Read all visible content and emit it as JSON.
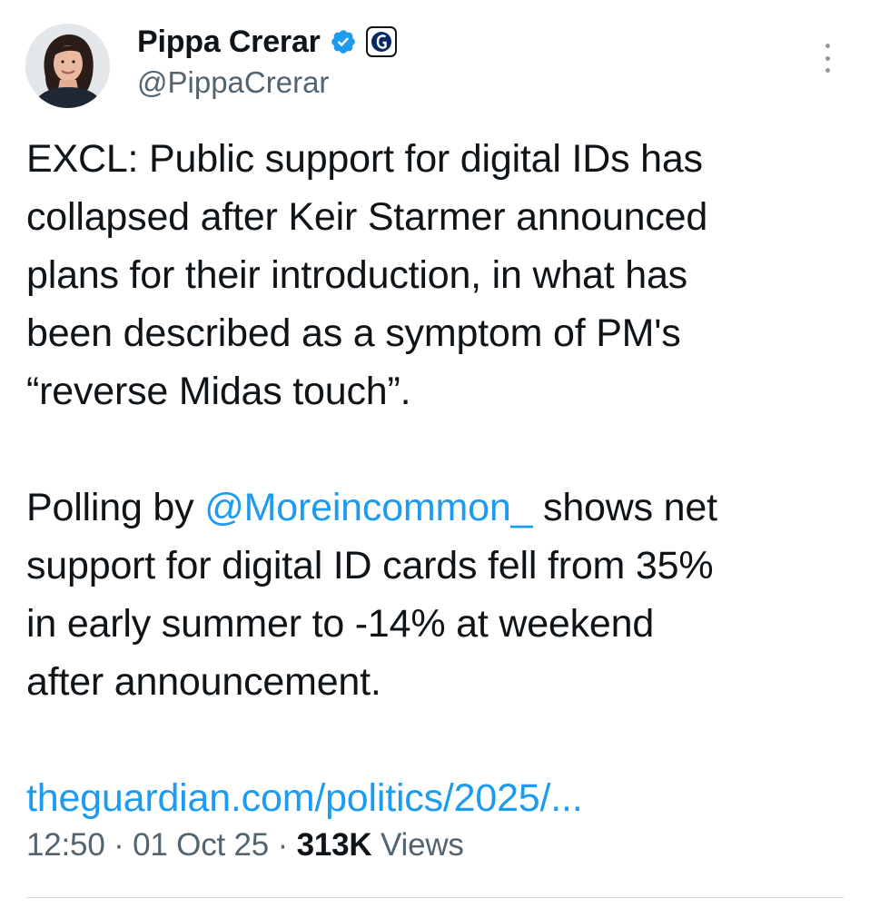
{
  "author": {
    "display_name": "Pippa Crerar",
    "handle": "@PippaCrerar",
    "verified_icon": "verified-badge-icon",
    "affiliation_icon": "guardian-logo-icon",
    "avatar_icon": "avatar-photo"
  },
  "colors": {
    "accent": "#1d9bf0",
    "text": "#0f1419",
    "muted": "#536471",
    "divider": "#cfd9de"
  },
  "tweet": {
    "paragraph1": [
      "EXCL: Public support for digital IDs has",
      "collapsed after Keir Starmer announced",
      "plans for their introduction, in what has",
      "been described as a symptom of PM's",
      "“reverse Midas touch”."
    ],
    "paragraph2": {
      "line1_prefix": "Polling by ",
      "mention": "@Moreincommon_",
      "line1_suffix": " shows net",
      "lines": [
        "support for digital ID cards fell from 35%",
        "in early summer to -14% at weekend",
        "after announcement."
      ]
    },
    "link": "theguardian.com/politics/2025/..."
  },
  "meta": {
    "time": "12:50",
    "sep1": " · ",
    "date": "01 Oct 25",
    "sep2": " · ",
    "views_count": "313K",
    "views_label": " Views"
  }
}
